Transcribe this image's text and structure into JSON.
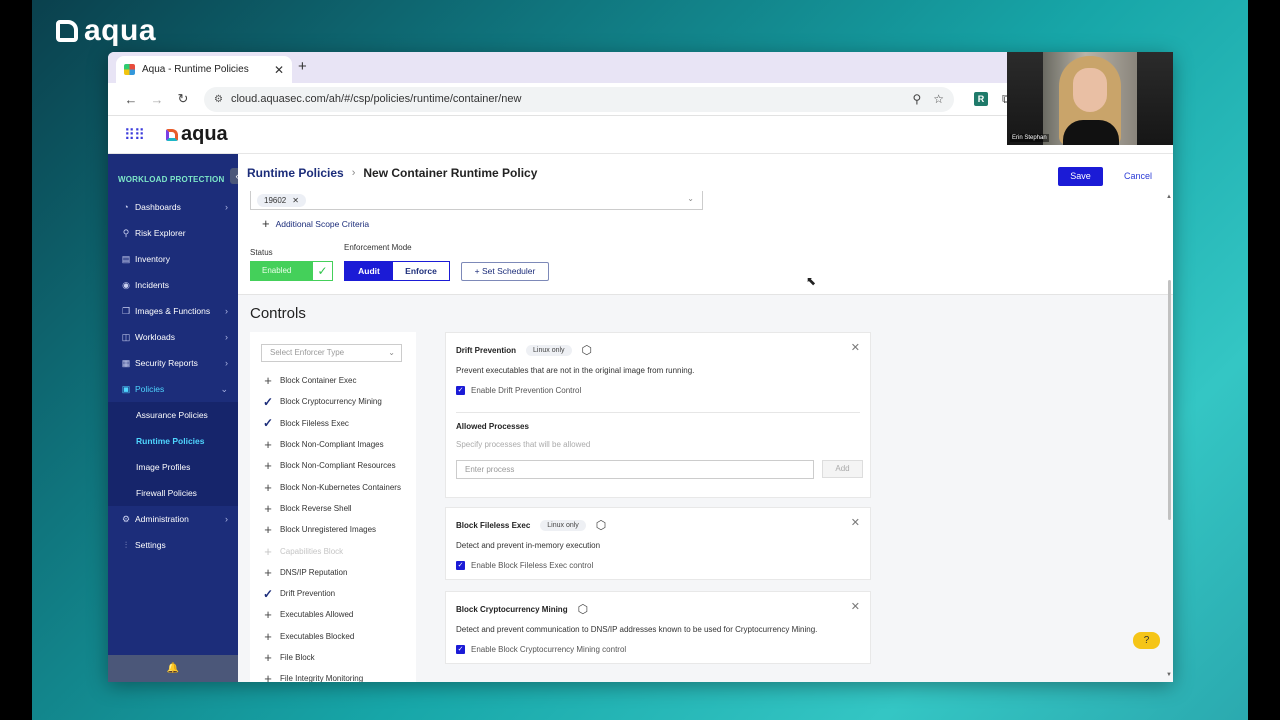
{
  "brand": {
    "name": "aqua"
  },
  "browser": {
    "tab_title": "Aqua - Runtime Policies",
    "new_tab": "+",
    "url": "cloud.aquasec.com/ah/#/csp/policies/runtime/container/new",
    "ext_label": "R"
  },
  "app": {
    "logo_text": "aqua"
  },
  "sidebar": {
    "section_title": "WORKLOAD PROTECTION",
    "items": [
      {
        "label": "Dashboards",
        "icon": "dashboard-icon",
        "glyph": "◔",
        "chevron": "›"
      },
      {
        "label": "Risk Explorer",
        "icon": "risk-explorer-icon",
        "glyph": "⚲",
        "chevron": ""
      },
      {
        "label": "Inventory",
        "icon": "inventory-icon",
        "glyph": "▤",
        "chevron": ""
      },
      {
        "label": "Incidents",
        "icon": "incidents-icon",
        "glyph": "◉",
        "chevron": ""
      },
      {
        "label": "Images & Functions",
        "icon": "images-icon",
        "glyph": "❐",
        "chevron": "›"
      },
      {
        "label": "Workloads",
        "icon": "workloads-icon",
        "glyph": "◫",
        "chevron": "›"
      },
      {
        "label": "Security Reports",
        "icon": "reports-icon",
        "glyph": "▦",
        "chevron": "›"
      },
      {
        "label": "Policies",
        "icon": "policies-icon",
        "glyph": "▣",
        "chevron": "⌄"
      }
    ],
    "policies_sub": [
      {
        "label": "Assurance Policies"
      },
      {
        "label": "Runtime Policies"
      },
      {
        "label": "Image Profiles"
      },
      {
        "label": "Firewall Policies"
      }
    ],
    "bottom_items": [
      {
        "label": "Administration",
        "icon": "administration-icon",
        "glyph": "⚙",
        "chevron": "›"
      },
      {
        "label": "Settings",
        "icon": "settings-icon",
        "glyph": "⫶",
        "chevron": ""
      }
    ],
    "collapse_glyph": "‹",
    "footer_glyph": "🔔"
  },
  "page": {
    "breadcrumb_link": "Runtime Policies",
    "breadcrumb_sep": "›",
    "title": "New Container Runtime Policy",
    "save": "Save",
    "cancel": "Cancel",
    "scope_chip": "19602",
    "scope_chip_x": "✕",
    "add_scope": "Additional Scope Criteria",
    "status_label": "Status",
    "status_value": "Enabled",
    "enforcement_label": "Enforcement Mode",
    "mode_audit": "Audit",
    "mode_enforce": "Enforce",
    "scheduler": "+ Set Scheduler"
  },
  "controls": {
    "title": "Controls",
    "enforcer_placeholder": "Select Enforcer Type",
    "items": [
      {
        "label": "Block Container Exec",
        "state": "add"
      },
      {
        "label": "Block Cryptocurrency Mining",
        "state": "checked"
      },
      {
        "label": "Block Fileless Exec",
        "state": "checked"
      },
      {
        "label": "Block Non-Compliant Images",
        "state": "add"
      },
      {
        "label": "Block Non-Compliant Resources",
        "state": "add"
      },
      {
        "label": "Block Non-Kubernetes Containers",
        "state": "add"
      },
      {
        "label": "Block Reverse Shell",
        "state": "add"
      },
      {
        "label": "Block Unregistered Images",
        "state": "add"
      },
      {
        "label": "Capabilities Block",
        "state": "disabled"
      },
      {
        "label": "DNS/IP Reputation",
        "state": "add"
      },
      {
        "label": "Drift Prevention",
        "state": "checked"
      },
      {
        "label": "Executables Allowed",
        "state": "add"
      },
      {
        "label": "Executables Blocked",
        "state": "add"
      },
      {
        "label": "File Block",
        "state": "add"
      },
      {
        "label": "File Integrity Monitoring",
        "state": "add"
      }
    ]
  },
  "cards": {
    "drift": {
      "title": "Drift Prevention",
      "badge": "Linux only",
      "desc": "Prevent executables that are not in the original image from running.",
      "check": "Enable Drift Prevention Control",
      "allowed_title": "Allowed Processes",
      "allowed_hint": "Specify processes that will be allowed",
      "input_placeholder": "Enter process",
      "add": "Add"
    },
    "fileless": {
      "title": "Block Fileless Exec",
      "badge": "Linux only",
      "desc": "Detect and prevent in-memory execution",
      "check": "Enable Block Fileless Exec control"
    },
    "crypto": {
      "title": "Block Cryptocurrency Mining",
      "desc": "Detect and prevent communication to DNS/IP addresses known to be used for Cryptocurrency Mining.",
      "check": "Enable Block Cryptocurrency Mining control"
    }
  },
  "webcam": {
    "name": "Erin Stephan"
  },
  "colors": {
    "sidebar": "#1c2d7a",
    "primary": "#1b1bd6",
    "enabled": "#44d05a",
    "accent": "#4fd6ff"
  }
}
